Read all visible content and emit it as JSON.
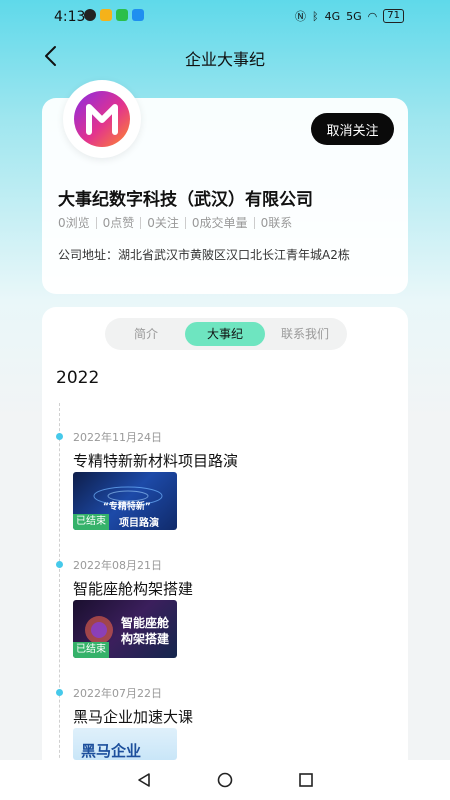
{
  "status_bar": {
    "time": "4:13",
    "network": "4G",
    "network2": "5G",
    "battery": "71"
  },
  "nav": {
    "title": "企业大事纪"
  },
  "company": {
    "follow_button": "取消关注",
    "name": "大事纪数字科技（武汉）有限公司",
    "stats": [
      "0浏览",
      "0点赞",
      "0关注",
      "0成交单量",
      "0联系"
    ],
    "address": "公司地址：湖北省武汉市黄陂区汉口北长江青年城A2栋"
  },
  "tabs": {
    "items": [
      "简介",
      "大事纪",
      "联系我们"
    ],
    "active": "大事纪"
  },
  "timeline": {
    "year": "2022",
    "events": [
      {
        "date": "2022年11月24日",
        "title": "专精特新新材料项目路演",
        "badge": "已结束",
        "thumb_line1": "“专精特新”",
        "thumb_line2": "项目路演"
      },
      {
        "date": "2022年08月21日",
        "title": "智能座舱构架搭建",
        "badge": "已结束",
        "thumb_line1": "智能座舱",
        "thumb_line2": "构架搭建"
      },
      {
        "date": "2022年07月22日",
        "title": "黑马企业加速大课",
        "thumb_line1": "黑马企业"
      }
    ]
  },
  "colors": {
    "accent_tab": "#6ee5c0",
    "timeline_dot": "#46c9ea",
    "badge": "#35b26a"
  }
}
